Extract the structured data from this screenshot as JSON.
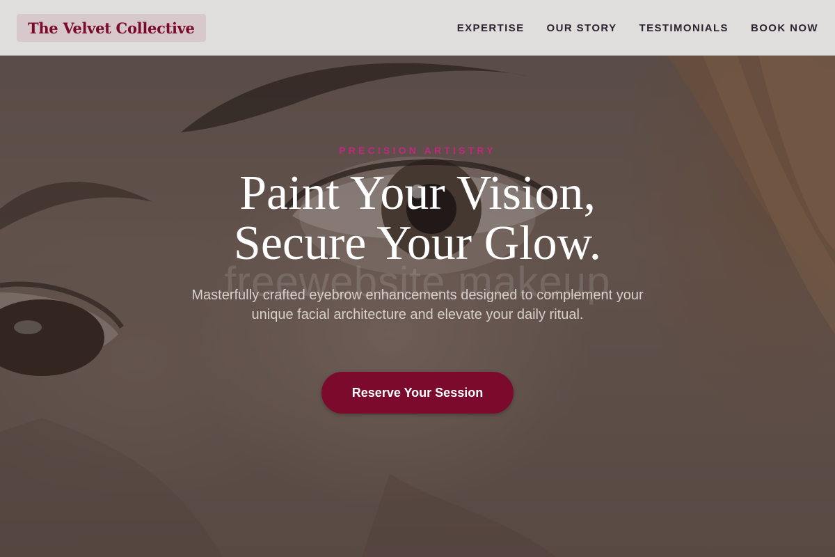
{
  "header": {
    "brand": "The Velvet Collective",
    "nav": [
      {
        "label": "EXPERTISE"
      },
      {
        "label": "OUR STORY"
      },
      {
        "label": "TESTIMONIALS"
      },
      {
        "label": "BOOK NOW"
      }
    ]
  },
  "hero": {
    "eyebrow": "PRECISION ARTISTRY",
    "headline_line1": "Paint Your Vision,",
    "headline_line2": "Secure Your Glow.",
    "watermark": "freewebsite makeup",
    "subtext": "Masterfully crafted eyebrow enhancements designed to complement your unique facial architecture and elevate your daily ritual.",
    "cta_label": "Reserve Your Session"
  },
  "colors": {
    "brand": "#7a0a2a",
    "accent_pink": "#c2297e",
    "cta_bg": "#7c0a2c",
    "header_bg": "#e6e4e3",
    "nav_text": "#2a2430"
  }
}
